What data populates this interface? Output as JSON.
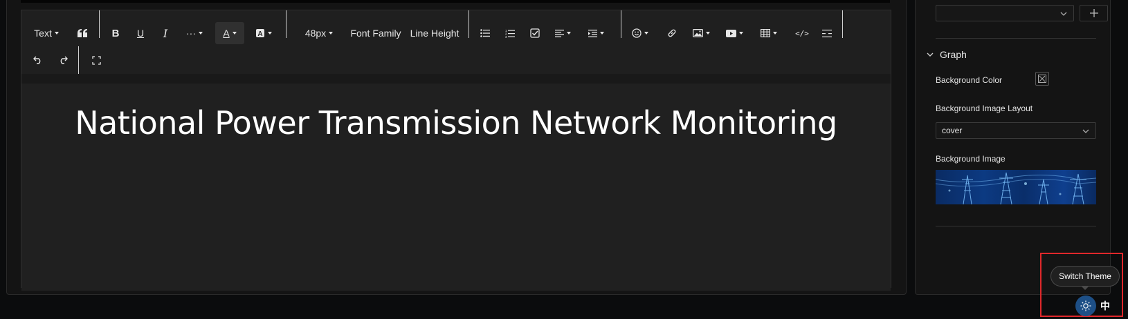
{
  "toolbar": {
    "text_style": "Text",
    "font_size": "48px",
    "font_family": "Font Family",
    "line_height": "Line Height"
  },
  "editor": {
    "headline": "National Power Transmission Network Monitoring"
  },
  "side_panel": {
    "top_select_value": "",
    "graph_section": "Graph",
    "background_color_label": "Background Color",
    "background_image_layout_label": "Background Image Layout",
    "background_image_layout_value": "cover",
    "background_image_label": "Background Image"
  },
  "floating": {
    "tooltip": "Switch Theme",
    "language": "中"
  },
  "colors": {
    "theme_button": "#1d4f86",
    "highlight": "#e0282b"
  }
}
